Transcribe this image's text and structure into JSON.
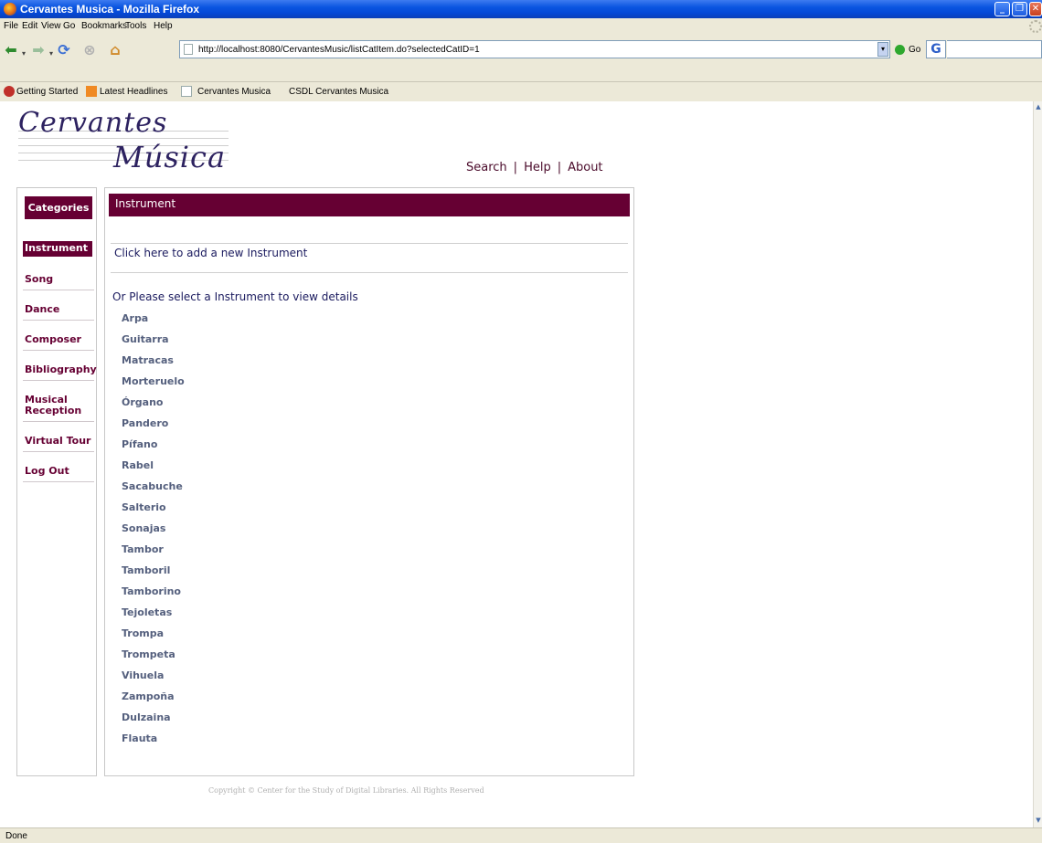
{
  "window": {
    "title": "Cervantes Musica - Mozilla Firefox"
  },
  "menu": {
    "items": [
      "File",
      "Edit",
      "View",
      "Go",
      "Bookmarks",
      "Tools",
      "Help"
    ]
  },
  "navbar": {
    "url": "http://localhost:8080/CervantesMusic/listCatItem.do?selectedCatID=1",
    "go_label": "Go"
  },
  "bookmarks": {
    "items": [
      "Getting Started",
      "Latest Headlines",
      "Cervantes Musica",
      "CSDL Cervantes Musica"
    ]
  },
  "site": {
    "logo_line1": "Cervantes",
    "logo_line2": "Música",
    "nav": {
      "search": "Search",
      "help": "Help",
      "about": "About",
      "separator": "|"
    }
  },
  "sidebar": {
    "header": "Categories",
    "items": [
      {
        "label": "Instrument",
        "active": true
      },
      {
        "label": "Song",
        "active": false
      },
      {
        "label": "Dance",
        "active": false
      },
      {
        "label": "Composer",
        "active": false
      },
      {
        "label": "Bibliography",
        "active": false
      },
      {
        "label": "Musical Reception",
        "active": false
      },
      {
        "label": "Virtual Tour",
        "active": false
      },
      {
        "label": "Log Out",
        "active": false
      }
    ]
  },
  "main": {
    "header": "Instrument",
    "add_link": "Click here to add a new Instrument",
    "select_msg": "Or Please select a Instrument to view details",
    "instruments": [
      "Arpa",
      "Guitarra",
      "Matracas",
      "Morteruelo",
      "Órgano",
      "Pandero",
      "Pífano",
      "Rabel",
      "Sacabuche",
      "Salterio",
      "Sonajas",
      "Tambor",
      "Tamboril",
      "Tamborino",
      "Tejoletas",
      "Trompa",
      "Trompeta",
      "Vihuela",
      "Zampoña",
      "Dulzaina",
      "Flauta"
    ]
  },
  "footer": {
    "copyright": "Copyright © Center for the Study of Digital Libraries. All Rights Reserved"
  },
  "status": {
    "text": "Done"
  },
  "colors": {
    "accent": "#660033",
    "link": "#1a1a5e",
    "list_item": "#55607e"
  }
}
